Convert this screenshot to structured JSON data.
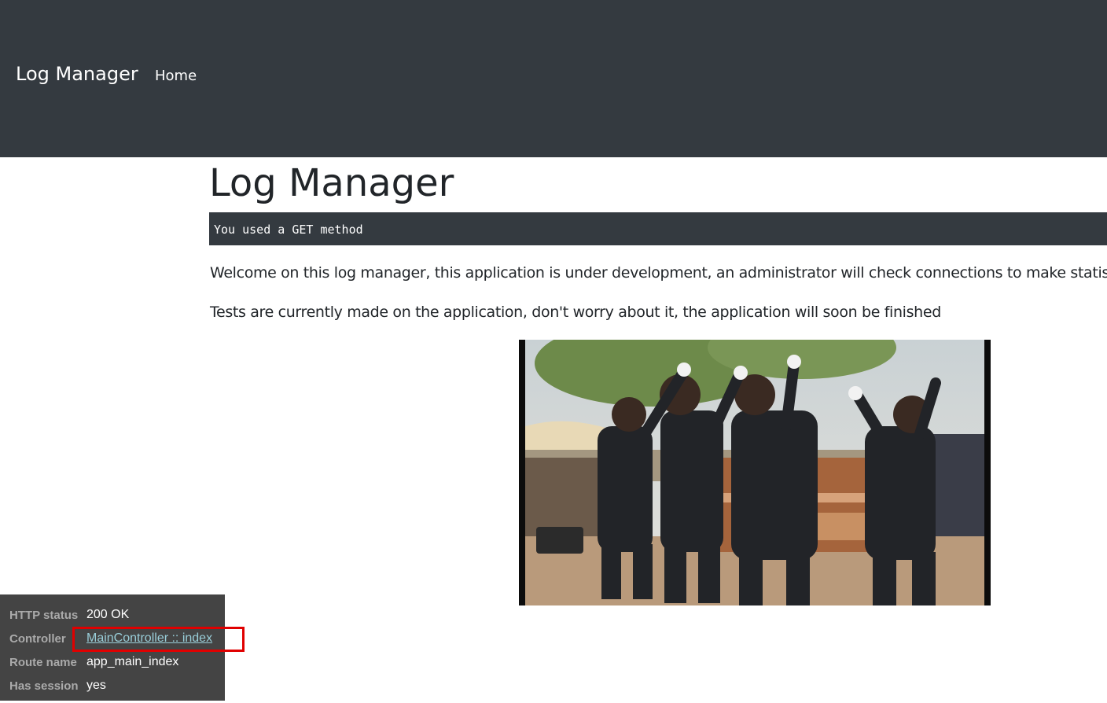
{
  "navbar": {
    "brand": "Log Manager",
    "links": [
      {
        "label": "Home"
      }
    ]
  },
  "main": {
    "title": "Log Manager",
    "method_message": "You used a GET method",
    "paragraphs": [
      "Welcome on this log manager, this application is under development, an administrator will check connections to make statistics",
      "Tests are currently made on the application, don't worry about it, the application will soon be finished"
    ]
  },
  "debug_toolbar": {
    "rows": [
      {
        "key": "HTTP status",
        "value": "200 OK"
      },
      {
        "key": "Controller",
        "value": "MainController :: index"
      },
      {
        "key": "Route name",
        "value": "app_main_index"
      },
      {
        "key": "Has session",
        "value": "yes"
      }
    ]
  },
  "colors": {
    "navbar_bg": "#343a40",
    "debug_bg": "#444444",
    "link": "#99cdd8",
    "highlight": "#e00000"
  }
}
